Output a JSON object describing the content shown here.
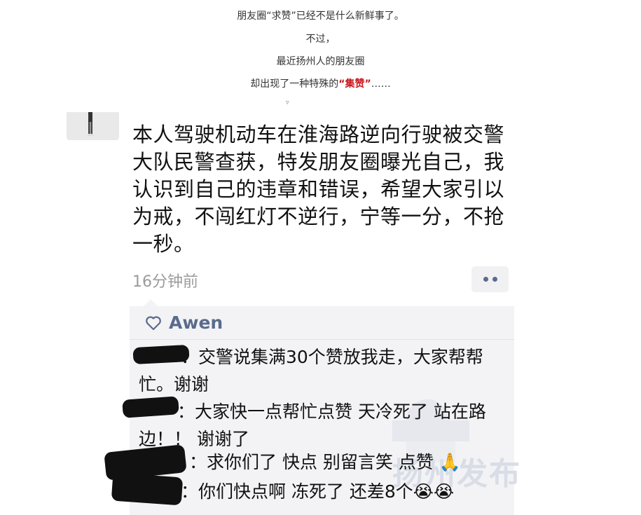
{
  "intro": {
    "line1": "朋友圈“求赞”已经不是什么新鲜事了。",
    "line2": "不过，",
    "line3": "最近扬州人的朋友圈",
    "line4_prefix": "却出现了一种特殊的",
    "line4_highlight": "“集赞”",
    "line4_suffix": "……",
    "arrow": "▿"
  },
  "post": {
    "text": "本人驾驶机动车在淮海路逆向行驶被交警大队民警查获，特发朋友圈曝光自己，我认识到自己的违章和错误，希望大家引以为戒，不闯红灯不逆行，宁等一分，不抢一秒。",
    "time": "16分钟前"
  },
  "likes": {
    "names": "Awen"
  },
  "comments": [
    {
      "text": "：交警说集满30个赞放我走，大家帮帮忙。谢谢"
    },
    {
      "text": "：大家快一点帮忙点赞 天冷死了 站在路边！！ 谢谢了"
    },
    {
      "text": "：求你们了 快点 别留言笑 点赞 🙏"
    },
    {
      "text": "：你们快点啊 冻死了 还差8个😭😭"
    }
  ],
  "watermark": {
    "text": "扬州发布"
  },
  "colors": {
    "accent_name": "#5a6b8c",
    "highlight_red": "#c8161d",
    "comment_bg": "#f3f3f5",
    "time_gray": "#9b9b9b"
  },
  "icons": [
    "heart-outline-icon",
    "more-dots-icon",
    "down-arrow-icon"
  ]
}
